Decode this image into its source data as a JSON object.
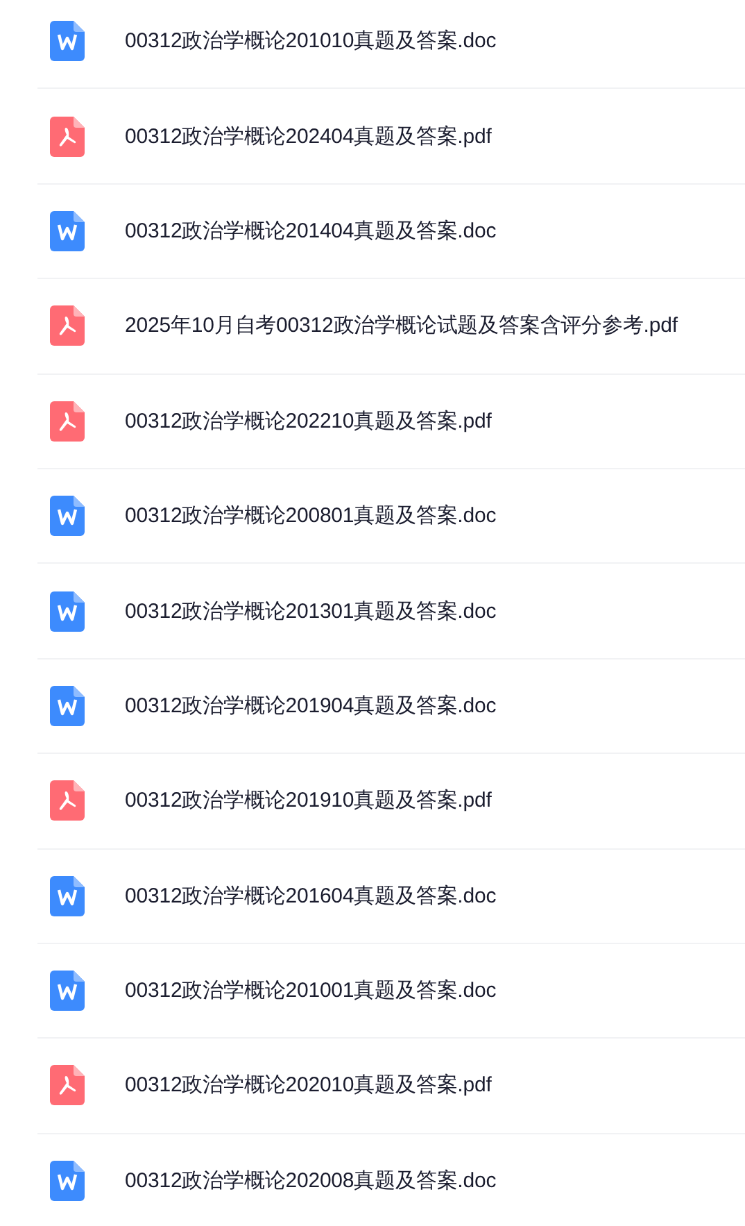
{
  "files": [
    {
      "kind": "doc",
      "name": "00312政治学概论201010真题及答案.doc"
    },
    {
      "kind": "pdf",
      "name": "00312政治学概论202404真题及答案.pdf"
    },
    {
      "kind": "doc",
      "name": "00312政治学概论201404真题及答案.doc"
    },
    {
      "kind": "pdf",
      "name": "2025年10月自考00312政治学概论试题及答案含评分参考.pdf"
    },
    {
      "kind": "pdf",
      "name": "00312政治学概论202210真题及答案.pdf"
    },
    {
      "kind": "doc",
      "name": "00312政治学概论200801真题及答案.doc"
    },
    {
      "kind": "doc",
      "name": "00312政治学概论201301真题及答案.doc"
    },
    {
      "kind": "doc",
      "name": "00312政治学概论201904真题及答案.doc"
    },
    {
      "kind": "pdf",
      "name": "00312政治学概论201910真题及答案.pdf"
    },
    {
      "kind": "doc",
      "name": "00312政治学概论201604真题及答案.doc"
    },
    {
      "kind": "doc",
      "name": "00312政治学概论201001真题及答案.doc"
    },
    {
      "kind": "pdf",
      "name": "00312政治学概论202010真题及答案.pdf"
    },
    {
      "kind": "doc",
      "name": "00312政治学概论202008真题及答案.doc"
    }
  ]
}
